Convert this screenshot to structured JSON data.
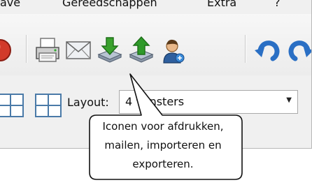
{
  "menubar": {
    "items": [
      "ave",
      "Gereedschappen",
      "Extra",
      "?"
    ]
  },
  "toolbar": {
    "icons": [
      "record-icon",
      "printer-icon",
      "mail-icon",
      "import-icon",
      "export-icon",
      "user-icon",
      "undo-icon",
      "redo-icon"
    ]
  },
  "layoutbar": {
    "label": "Layout:",
    "select_value": "4 vensters"
  },
  "tooltip": {
    "lines": [
      "Iconen voor afdrukken,",
      "mailen, importeren en",
      "exporteren."
    ]
  },
  "colors": {
    "import_green": "#3aa12d",
    "export_green": "#2f9a2a",
    "undo_blue": "#2a6fc4",
    "record_red": "#d23a2a"
  }
}
